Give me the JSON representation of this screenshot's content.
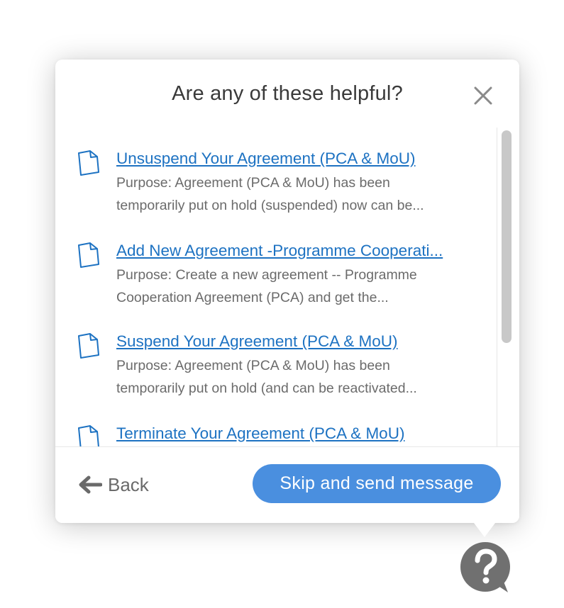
{
  "panel": {
    "title": "Are any of these helpful?"
  },
  "articles": [
    {
      "title": "Unsuspend Your Agreement (PCA & MoU)",
      "desc_line1": "Purpose: Agreement (PCA & MoU) has been",
      "desc_line2": "temporarily put on hold (suspended) now can be..."
    },
    {
      "title": "Add New Agreement -Programme Cooperati...",
      "desc_line1": "Purpose: Create a new agreement -- Programme",
      "desc_line2": "Cooperation Agreement (PCA) and get the..."
    },
    {
      "title": "Suspend Your Agreement (PCA & MoU)",
      "desc_line1": "Purpose: Agreement (PCA & MoU) has been",
      "desc_line2": "temporarily put on hold (and can be reactivated..."
    },
    {
      "title": "Terminate Your Agreement (PCA & MoU)",
      "desc_line1": "",
      "desc_line2": ""
    }
  ],
  "footer": {
    "back_label": "Back",
    "skip_label": "Skip and send message"
  },
  "colors": {
    "link": "#1d72c2",
    "primary_button": "#4a8fdf",
    "help_bubble": "#707070",
    "scroll_thumb": "#c8c8c8"
  },
  "icons": {
    "close": "close-icon",
    "document": "document-icon",
    "back": "arrow-left-icon",
    "help": "question-bubble-icon"
  }
}
